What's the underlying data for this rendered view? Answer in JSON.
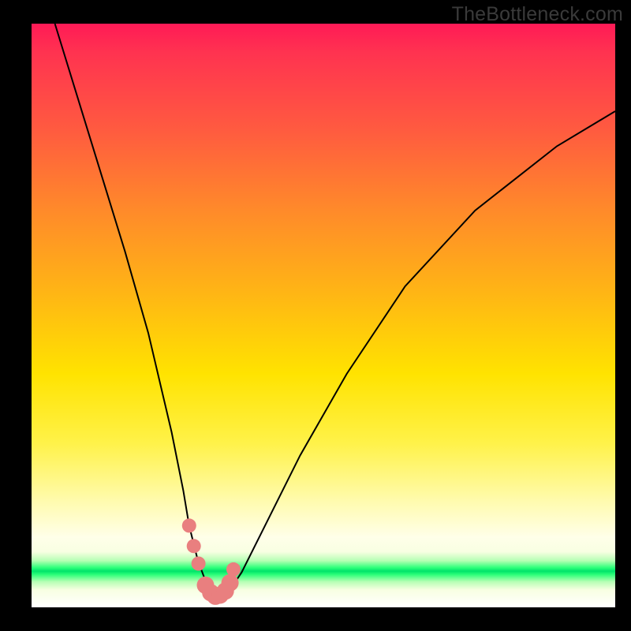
{
  "watermark": "TheBottleneck.com",
  "colors": {
    "background": "#000000",
    "gradient_top": "#ff1a56",
    "gradient_mid": "#ffe300",
    "gradient_band": "#00e36a",
    "curve": "#000000",
    "marker": "#e97f7f"
  },
  "chart_data": {
    "type": "line",
    "title": "",
    "xlabel": "",
    "ylabel": "",
    "xlim": [
      0,
      100
    ],
    "ylim": [
      0,
      100
    ],
    "annotations": [
      "TheBottleneck.com"
    ],
    "grid": false,
    "legend": false,
    "series": [
      {
        "name": "bottleneck-curve",
        "x": [
          4,
          8,
          12,
          16,
          20,
          24,
          26,
          27,
          28.5,
          30,
          31,
          32,
          33,
          34,
          36,
          40,
          46,
          54,
          64,
          76,
          90,
          100
        ],
        "values": [
          100,
          87,
          74,
          61,
          47,
          30,
          20,
          14,
          8,
          4,
          2.3,
          1.8,
          2,
          3,
          6,
          14,
          26,
          40,
          55,
          68,
          79,
          85
        ]
      }
    ],
    "markers": {
      "name": "highlight-dots",
      "x": [
        27.0,
        27.8,
        28.6,
        29.8,
        30.7,
        31.5,
        32.3,
        33.2,
        34.0,
        34.6
      ],
      "values": [
        14.0,
        10.5,
        7.5,
        3.8,
        2.5,
        1.9,
        2.1,
        2.8,
        4.2,
        6.5
      ],
      "radius": [
        9,
        9,
        9,
        11,
        11,
        11,
        11,
        11,
        11,
        9
      ]
    }
  }
}
